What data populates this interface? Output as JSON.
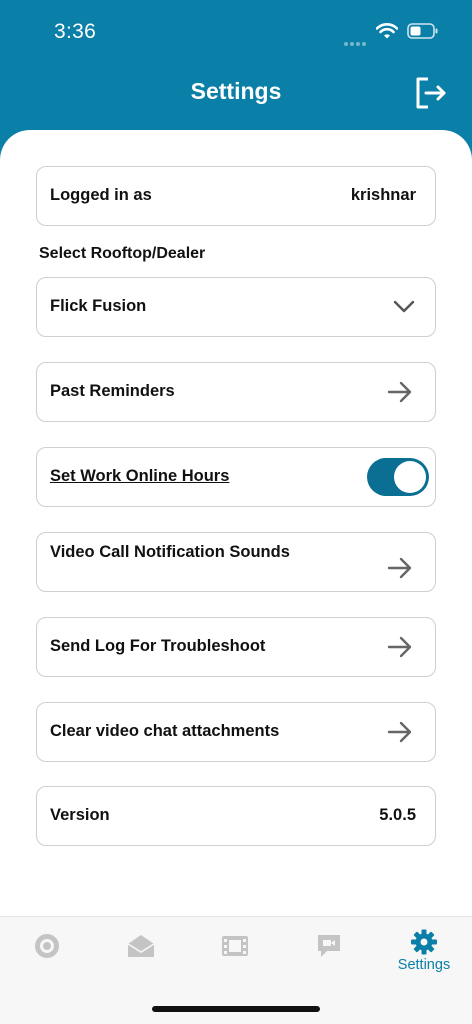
{
  "status_bar": {
    "time": "3:36"
  },
  "header": {
    "title": "Settings"
  },
  "logged_in": {
    "label": "Logged in as",
    "value": "krishnar"
  },
  "dealer": {
    "section_label": "Select Rooftop/Dealer",
    "selected": "Flick Fusion"
  },
  "rows": {
    "past_reminders": "Past Reminders",
    "work_online_hours": "Set Work Online Hours",
    "video_call_sounds": "Video Call Notification Sounds",
    "send_log": "Send Log For Troubleshoot",
    "clear_attachments": "Clear video chat attachments"
  },
  "work_online_hours_enabled": true,
  "version": {
    "label": "Version",
    "value": "5.0.5"
  },
  "tabs": [
    {
      "icon": "target-icon",
      "label": ""
    },
    {
      "icon": "envelope-icon",
      "label": ""
    },
    {
      "icon": "film-icon",
      "label": ""
    },
    {
      "icon": "video-chat-icon",
      "label": ""
    },
    {
      "icon": "gear-icon",
      "label": "Settings",
      "active": true
    }
  ],
  "colors": {
    "brand": "#0a7fa8",
    "toggle_on": "#0a6f93",
    "tab_inactive": "#c4c4c4"
  }
}
